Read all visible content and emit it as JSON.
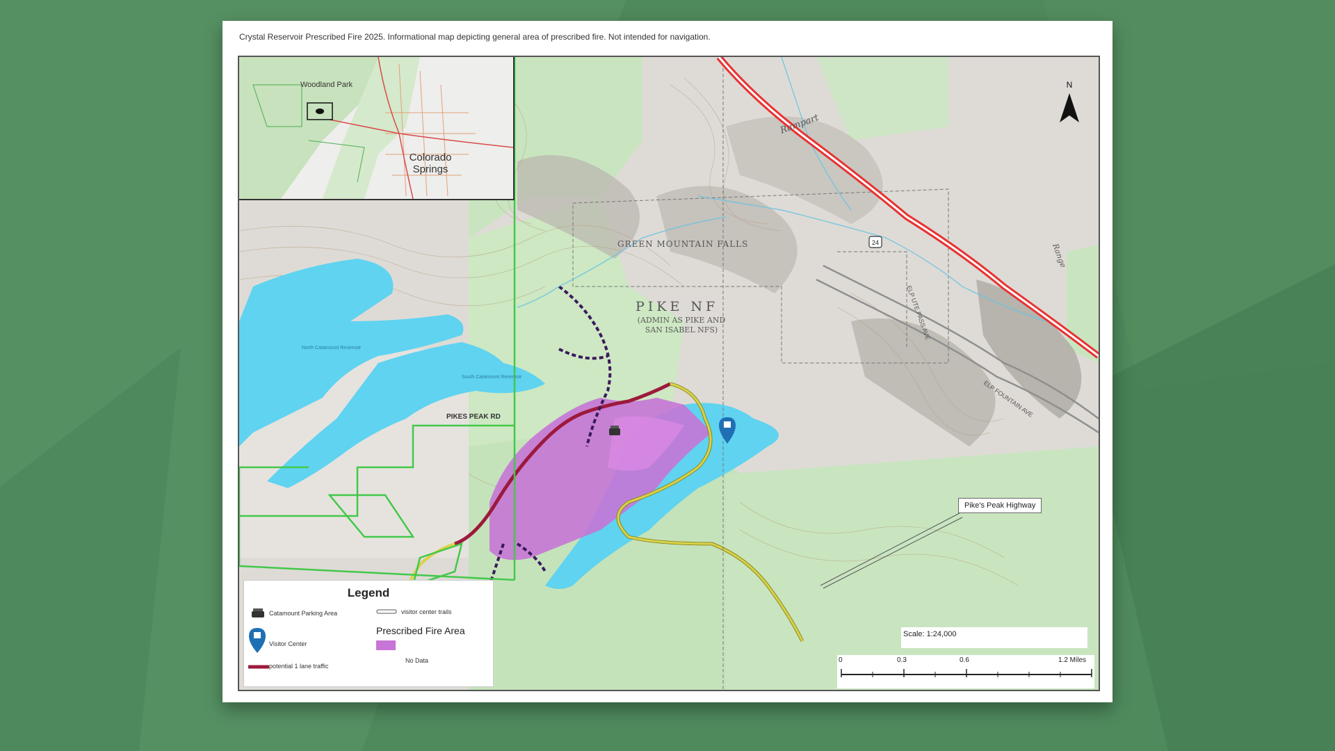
{
  "caption": "Crystal Reservoir Prescribed Fire 2025.  Informational map depicting general area of prescribed fire.   Not intended for navigation.",
  "inset": {
    "woodland_park": "Woodland Park",
    "colorado_springs": "Colorado Springs"
  },
  "labels": {
    "pike_nf": "PIKE NF",
    "pike_nf_sub": "(ADMIN AS PIKE AND SAN ISABEL NFS)",
    "green_mountain_falls": "GREEN MOUNTAIN FALLS",
    "pikes_peak_rd": "PIKES PEAK RD",
    "route_24": "24",
    "rampart": "Rampart",
    "range": "Range",
    "fountain_ave": "ELP FOUNTAIN AVE",
    "ute_pass_ave": "ELP UTE PASS AVE",
    "south_reservoir": "South Catamount Reservoir",
    "north_reservoir": "North Catamount Reservoir",
    "north_arrow": "N"
  },
  "callout": "Pike's Peak Highway",
  "legend": {
    "title": "Legend",
    "parking": "Catamount Parking Area",
    "visitor_center": "Visitor Center",
    "one_lane": "potential 1 lane traffic",
    "trails": "visitor center trails",
    "fire_area": "Prescribed Fire Area",
    "no_data": "No Data"
  },
  "scale": {
    "text": "Scale: 1:24,000",
    "ticks": [
      "0",
      "0.3",
      "0.6",
      "1.2 Miles"
    ]
  },
  "colors": {
    "water": "#5fd3f0",
    "fire": "#c775d6",
    "one_lane": "#9c1a3c",
    "highway": "#e83232",
    "boundary": "#43c84a",
    "forest": "#c9e5c0",
    "trail": "#3b1a5c",
    "yellow_road": "#d9d24a"
  },
  "icons": [
    "parking-icon",
    "visitor-center-icon",
    "north-arrow-icon"
  ]
}
